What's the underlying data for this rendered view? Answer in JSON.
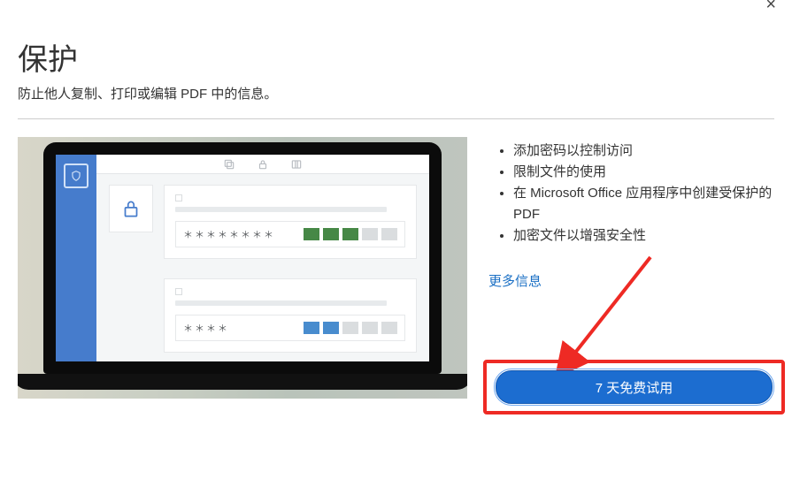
{
  "header": {
    "title": "保护",
    "subtitle": "防止他人复制、打印或编辑 PDF 中的信息。"
  },
  "features": [
    "添加密码以控制访问",
    "限制文件的使用",
    "在 Microsoft Office 应用程序中创建受保护的 PDF",
    "加密文件以增强安全性"
  ],
  "more_link": "更多信息",
  "cta": {
    "label": "7 天免费试用"
  },
  "hero_icons": {
    "rail": "shield-icon",
    "toolbar": [
      "copy-icon",
      "lock-icon",
      "columns-icon"
    ],
    "lock_card": "lock-icon"
  },
  "hero_forms": {
    "card1": {
      "dots": "＊＊＊＊＊＊＊＊",
      "strength": [
        "green",
        "green",
        "green",
        "grey",
        "grey"
      ]
    },
    "card2": {
      "dots": "＊＊＊＊",
      "strength": [
        "blue",
        "blue",
        "grey",
        "grey",
        "grey"
      ]
    }
  },
  "colors": {
    "accent_blue": "#1c6dd0",
    "link_blue": "#1a6fc4",
    "highlight_red": "#ee2a24"
  }
}
